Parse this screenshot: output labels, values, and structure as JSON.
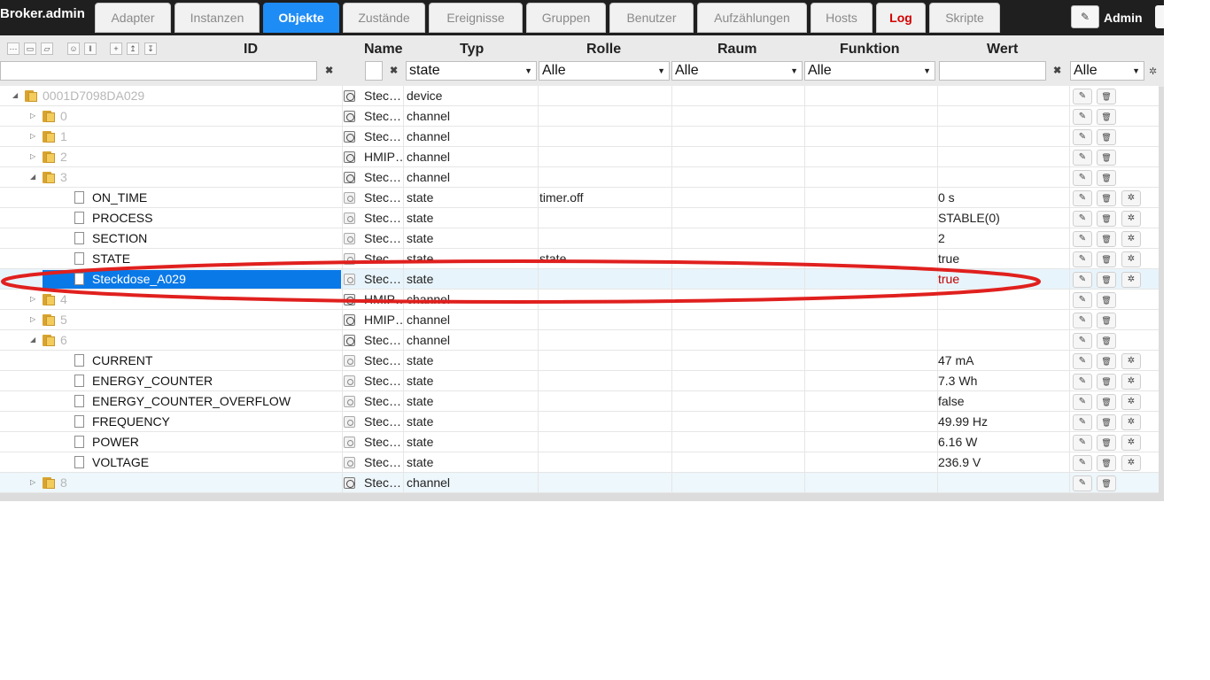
{
  "app": {
    "title": "Broker.admin",
    "admin_label": "Admin",
    "admin_icon": "pencil-icon"
  },
  "tabs": [
    {
      "label": "Adapter",
      "active": false
    },
    {
      "label": "Instanzen",
      "active": false
    },
    {
      "label": "Objekte",
      "active": true
    },
    {
      "label": "Zustände",
      "active": false
    },
    {
      "label": "Ereignisse",
      "active": false
    },
    {
      "label": "Gruppen",
      "active": false
    },
    {
      "label": "Benutzer",
      "active": false
    },
    {
      "label": "Aufzählungen",
      "active": false
    },
    {
      "label": "Hosts",
      "active": false
    },
    {
      "label": "Log",
      "active": false
    },
    {
      "label": "Skripte",
      "active": false
    }
  ],
  "header": {
    "columns": {
      "id": "ID",
      "name": "Name",
      "typ": "Typ",
      "rolle": "Rolle",
      "raum": "Raum",
      "funktion": "Funktion",
      "wert": "Wert"
    },
    "filters": {
      "id": "",
      "name": "",
      "typ": "state",
      "rolle": "Alle",
      "raum": "Alle",
      "funktion": "Alle",
      "wert": "",
      "actions": "Alle"
    },
    "toolbar_icons": [
      "list-icon",
      "folder-icon",
      "folder-open-icon",
      "user-icon",
      "columns-icon",
      "plus-icon",
      "upload-icon",
      "download-icon"
    ]
  },
  "rows": [
    {
      "id": "0001D7098DA029",
      "name": "Stec…",
      "typ": "device",
      "rolle": "",
      "wert": ""
    },
    {
      "id": "0",
      "name": "Stec…",
      "typ": "channel",
      "rolle": "",
      "wert": ""
    },
    {
      "id": "1",
      "name": "Stec…",
      "typ": "channel",
      "rolle": "",
      "wert": ""
    },
    {
      "id": "2",
      "name": "HMIP…",
      "typ": "channel",
      "rolle": "",
      "wert": ""
    },
    {
      "id": "3",
      "name": "Stec…",
      "typ": "channel",
      "rolle": "",
      "wert": ""
    },
    {
      "id": "ON_TIME",
      "name": "Stec…",
      "typ": "state",
      "rolle": "timer.off",
      "wert": "0 s"
    },
    {
      "id": "PROCESS",
      "name": "Stec…",
      "typ": "state",
      "rolle": "",
      "wert": "STABLE(0)"
    },
    {
      "id": "SECTION",
      "name": "Stec…",
      "typ": "state",
      "rolle": "",
      "wert": "2"
    },
    {
      "id": "STATE",
      "name": "Stec…",
      "typ": "state",
      "rolle": "state",
      "wert": "true"
    },
    {
      "id": "Steckdose_A029",
      "name": "Stec…",
      "typ": "state",
      "rolle": "",
      "wert": "true"
    },
    {
      "id": "4",
      "name": "HMIP…",
      "typ": "channel",
      "rolle": "",
      "wert": ""
    },
    {
      "id": "5",
      "name": "HMIP…",
      "typ": "channel",
      "rolle": "",
      "wert": ""
    },
    {
      "id": "6",
      "name": "Stec…",
      "typ": "channel",
      "rolle": "",
      "wert": ""
    },
    {
      "id": "CURRENT",
      "name": "Stec…",
      "typ": "state",
      "rolle": "",
      "wert": "47 mA"
    },
    {
      "id": "ENERGY_COUNTER",
      "name": "Stec…",
      "typ": "state",
      "rolle": "",
      "wert": "7.3 Wh"
    },
    {
      "id": "ENERGY_COUNTER_OVERFLOW",
      "name": "Stec…",
      "typ": "state",
      "rolle": "",
      "wert": "false"
    },
    {
      "id": "FREQUENCY",
      "name": "Stec…",
      "typ": "state",
      "rolle": "",
      "wert": "49.99 Hz"
    },
    {
      "id": "POWER",
      "name": "Stec…",
      "typ": "state",
      "rolle": "",
      "wert": "6.16 W"
    },
    {
      "id": "VOLTAGE",
      "name": "Stec…",
      "typ": "state",
      "rolle": "",
      "wert": "236.9 V"
    },
    {
      "id": "8",
      "name": "Stec…",
      "typ": "channel",
      "rolle": "",
      "wert": ""
    }
  ],
  "colors": {
    "active_tab": "#1e8cf5",
    "log_tab": "#d40000",
    "selection": "#0a79e8",
    "value_red": "#c00000",
    "annotation": "#e0201e"
  }
}
